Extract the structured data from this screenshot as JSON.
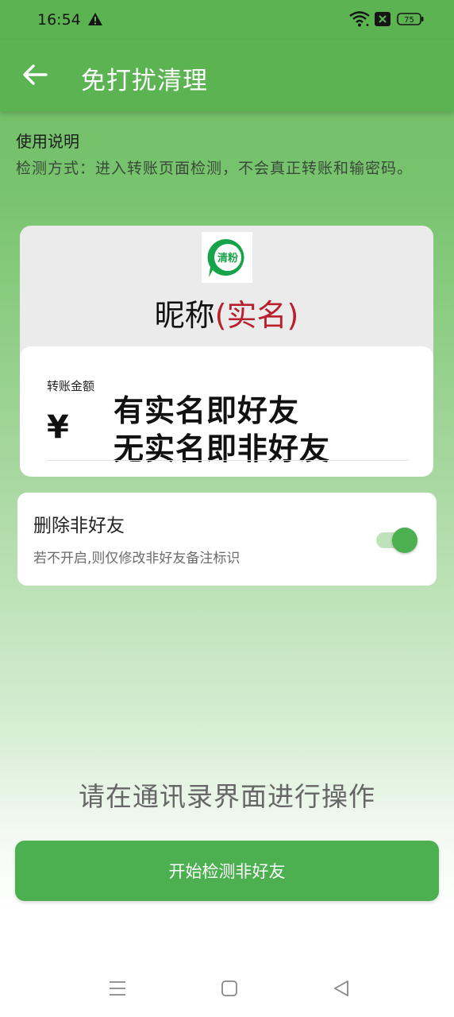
{
  "status": {
    "time": "16:54",
    "battery": "75"
  },
  "appbar": {
    "title": "免打扰清理"
  },
  "instructions": {
    "title": "使用说明",
    "desc": "检测方式：进入转账页面检测，不会真正转账和输密码。"
  },
  "demo": {
    "logo_text": "清粉",
    "nickname": "昵称",
    "realname": "(实名)",
    "amount_label": "转账金额",
    "currency": "¥",
    "line1": "有实名即好友",
    "line2": "无实名即非好友"
  },
  "option": {
    "title": "删除非好友",
    "subtitle": "若不开启,则仅修改非好友备注标识",
    "enabled": true
  },
  "hint": "请在通讯录界面进行操作",
  "start_button": "开始检测非好友",
  "colors": {
    "primary": "#4caf50",
    "appbar": "#5cb352",
    "accent_red": "#b9202d"
  },
  "icons": [
    "warning-icon",
    "wifi-icon",
    "x-icon",
    "battery-icon",
    "back-arrow-icon",
    "app-logo-icon",
    "menu-icon",
    "home-icon",
    "nav-back-icon"
  ]
}
